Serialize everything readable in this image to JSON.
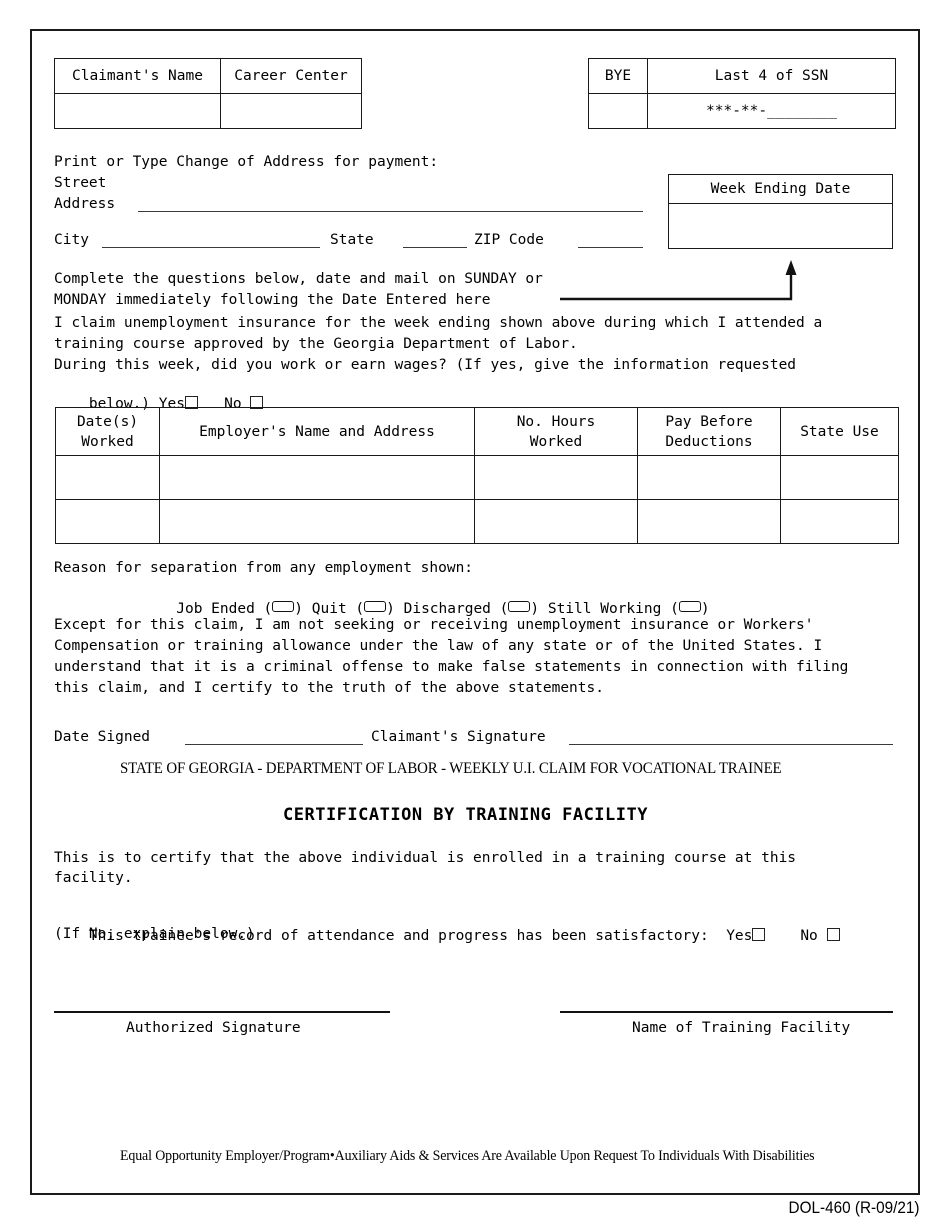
{
  "document": {
    "form_number": "DOL-460 (R-09/21)",
    "state_line": "STATE OF GEORGIA - DEPARTMENT OF LABOR - WEEKLY U.I. CLAIM FOR VOCATIONAL TRAINEE",
    "equal_opportunity": "Equal Opportunity Employer/Program•Auxiliary Aids & Services Are Available Upon Request To Individuals With Disabilities"
  },
  "header": {
    "claimant_name_label": "Claimant's Name",
    "career_center_label": "Career Center",
    "claimant_name_value": "",
    "career_center_value": "",
    "bye_label": "BYE",
    "bye_value": "",
    "ssn_label": "Last 4 of SSN",
    "ssn_value": "***-**-________"
  },
  "address": {
    "instruction": "Print or Type Change of Address for payment:",
    "street_label_line1": "Street",
    "street_label_line2": "Address",
    "city_label": "City",
    "state_label": "State",
    "zip_label": "ZIP Code",
    "street_value": "",
    "city_value": "",
    "state_value": "",
    "zip_value": ""
  },
  "week_ending": {
    "label": "Week Ending Date",
    "value": ""
  },
  "instructions": {
    "mail_line1": "Complete the questions below, date and mail on SUNDAY or",
    "mail_line2": "MONDAY immediately following the Date Entered here",
    "claim_line1": "I claim unemployment insurance for the week ending shown above during which I attended a",
    "claim_line2": "training course approved by the Georgia Department of Labor.",
    "work_question_line1": "During this week, did you work or earn wages? (If yes, give the information requested",
    "work_question_line2": "below.)",
    "yes_label": "Yes",
    "no_label": "No",
    "yes_checked": false,
    "no_checked": false
  },
  "employment_table": {
    "columns": [
      "Date(s)\nWorked",
      "Employer's Name and Address",
      "No. Hours\nWorked",
      "Pay Before\nDeductions",
      "State Use"
    ],
    "rows": [
      [
        "",
        "",
        "",
        "",
        ""
      ],
      [
        "",
        "",
        "",
        "",
        ""
      ]
    ]
  },
  "separation": {
    "prompt": "Reason for separation from any employment shown:",
    "options": [
      {
        "label": "Job Ended",
        "checked": false
      },
      {
        "label": "Quit",
        "checked": false
      },
      {
        "label": "Discharged",
        "checked": false
      },
      {
        "label": "Still Working",
        "checked": false
      }
    ]
  },
  "certification": {
    "line1": "Except for this claim, I am not seeking or receiving unemployment insurance or Workers'",
    "line2": "Compensation or training allowance under the law of any state or of the United States. I",
    "line3": "understand that it is a criminal offense to make false statements in connection with filing",
    "line4": "this claim, and I certify to the truth of the above statements.",
    "date_signed_label": "Date Signed",
    "date_signed_value": "",
    "claimant_signature_label": "Claimant's Signature",
    "claimant_signature_value": ""
  },
  "training_facility": {
    "heading": "CERTIFICATION BY TRAINING FACILITY",
    "enrolled_line1": "This is to certify that the above individual is enrolled in a training course at this",
    "enrolled_line2": "facility.",
    "record_line": "This trainee's record of attendance and progress has been satisfactory:",
    "yes_label": "Yes",
    "no_label": "No",
    "yes_checked": false,
    "no_checked": false,
    "explain_note": "(If No, explain below.)",
    "authorized_signature_label": "Authorized Signature",
    "authorized_signature_value": "",
    "facility_name_label": "Name of Training Facility",
    "facility_name_value": ""
  },
  "colors": {
    "ink": "#000000",
    "rule": "#3a3a3a",
    "border": "#1a1a1a"
  }
}
